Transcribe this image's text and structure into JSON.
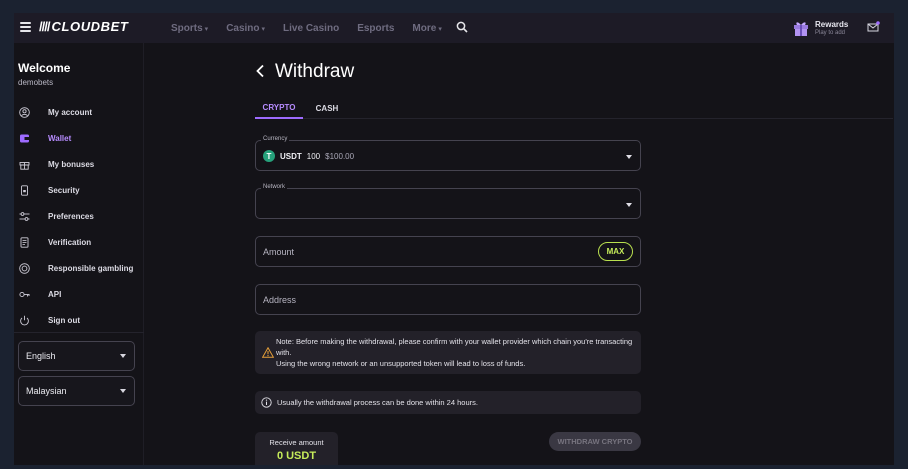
{
  "header": {
    "logo_text": "CLOUDBET",
    "nav": [
      {
        "label": "Sports",
        "has_dropdown": true
      },
      {
        "label": "Casino",
        "has_dropdown": true
      },
      {
        "label": "Live Casino",
        "has_dropdown": false
      },
      {
        "label": "Esports",
        "has_dropdown": false
      },
      {
        "label": "More",
        "has_dropdown": true
      }
    ],
    "rewards": {
      "title": "Rewards",
      "subtitle": "Play to add"
    }
  },
  "sidebar": {
    "welcome": "Welcome",
    "username": "demobets",
    "items": [
      {
        "label": "My account",
        "icon": "user-circle-icon",
        "active": false
      },
      {
        "label": "Wallet",
        "icon": "wallet-icon",
        "active": true
      },
      {
        "label": "My bonuses",
        "icon": "gift-icon",
        "active": false
      },
      {
        "label": "Security",
        "icon": "phone-lock-icon",
        "active": false
      },
      {
        "label": "Preferences",
        "icon": "sliders-icon",
        "active": false
      },
      {
        "label": "Verification",
        "icon": "document-icon",
        "active": false
      },
      {
        "label": "Responsible gambling",
        "icon": "shield-circle-icon",
        "active": false
      },
      {
        "label": "API",
        "icon": "key-icon",
        "active": false
      },
      {
        "label": "Sign out",
        "icon": "power-icon",
        "active": false
      }
    ],
    "language_select": "English",
    "region_select": "Malaysian"
  },
  "main": {
    "title": "Withdraw",
    "tabs": [
      {
        "label": "CRYPTO",
        "active": true
      },
      {
        "label": "CASH",
        "active": false
      }
    ],
    "currency": {
      "legend": "Currency",
      "code": "USDT",
      "amount": "100",
      "usd_value": "$100.00"
    },
    "network": {
      "legend": "Network",
      "value": ""
    },
    "amount_field": {
      "placeholder": "Amount",
      "max_label": "MAX"
    },
    "address_field": {
      "placeholder": "Address"
    },
    "note": {
      "line1": "Note: Before making the withdrawal, please confirm with your wallet provider which chain you're transacting with.",
      "line2": "Using the wrong network or an unsupported token will lead to loss of funds."
    },
    "info": "Usually the withdrawal process can be done within 24 hours.",
    "receive": {
      "label": "Receive amount",
      "value": "0 USDT"
    },
    "withdraw_button": "WITHDRAW CRYPTO"
  },
  "colors": {
    "accent_purple": "#9e6bff",
    "accent_lime": "#c6ec5a",
    "tether_green": "#26a17b"
  }
}
